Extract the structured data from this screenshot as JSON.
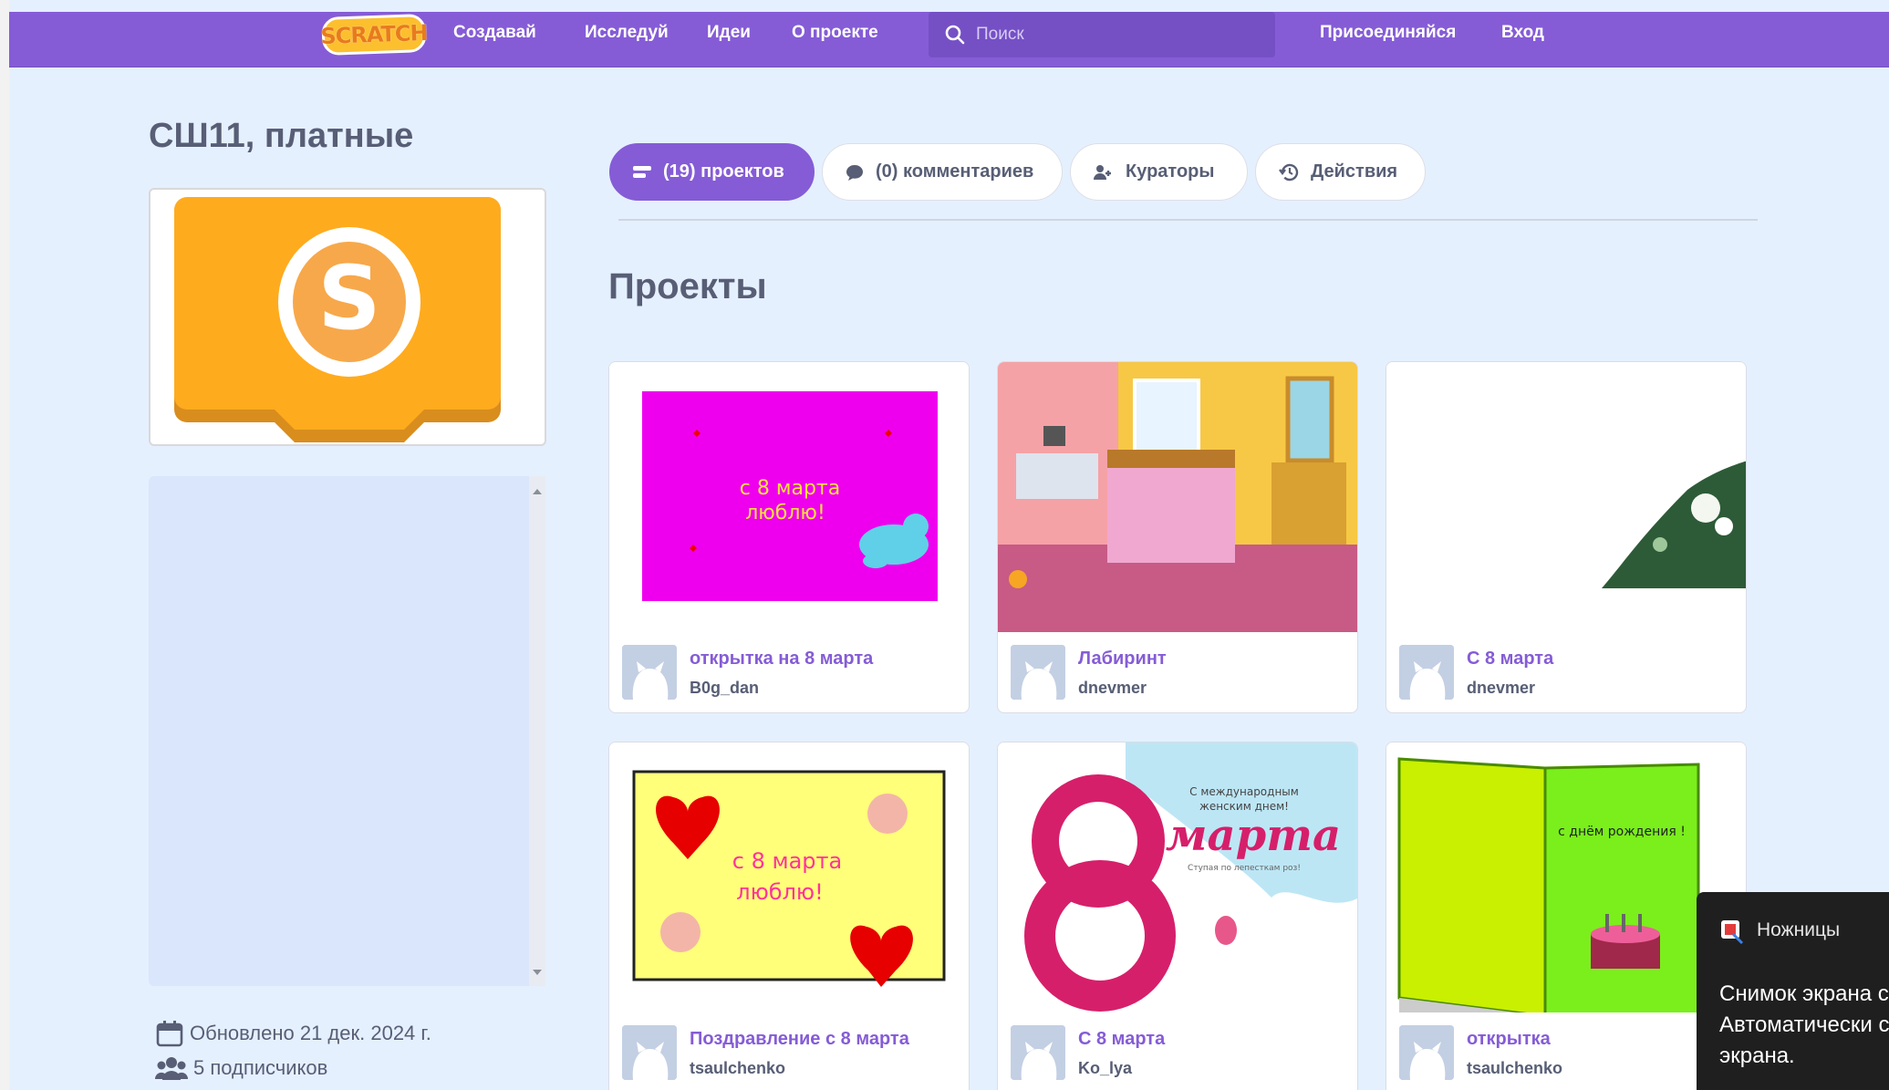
{
  "nav": {
    "logo": "SCRATCH",
    "create": "Создавай",
    "explore": "Исследуй",
    "ideas": "Идеи",
    "about": "О проекте",
    "search_placeholder": "Поиск",
    "join": "Присоединяйся",
    "signin": "Вход"
  },
  "studio": {
    "title": "СШ11, платные",
    "updated": "Обновлено 21 дек. 2024 г.",
    "followers": "5 подписчиков"
  },
  "tabs": {
    "projects": "(19) проектов",
    "comments": "(0) комментариев",
    "curators": "Кураторы",
    "activity": "Действия"
  },
  "section_title": "Проекты",
  "projects": [
    {
      "title": "открытка на 8 марта",
      "author": "B0g_dan",
      "thumb_text_1": "с 8 марта",
      "thumb_text_2": "люблю!"
    },
    {
      "title": "Лабиринт",
      "author": "dnevmer"
    },
    {
      "title": "С 8 марта",
      "author": "dnevmer"
    },
    {
      "title": "Поздравление с 8 марта",
      "author": "tsaulchenko",
      "thumb_text_1": "с 8 марта",
      "thumb_text_2": "люблю!"
    },
    {
      "title": "С 8 марта",
      "author": "Ko_lya",
      "thumb_text_1": "С международным",
      "thumb_text_2": "женским днем!",
      "thumb_text_3": "марта",
      "thumb_text_4": "Ступая по лепесткам роз!"
    },
    {
      "title": "открытка",
      "author": "tsaulchenko",
      "thumb_text_1": "с днём рождения !"
    }
  ],
  "toast": {
    "app": "Ножницы",
    "line1": "Снимок экрана с",
    "line2": "Автоматически с",
    "line3": "экрана."
  },
  "colors": {
    "accent": "#855cd6",
    "page_bg": "#e5f0ff",
    "text": "#575e75"
  }
}
